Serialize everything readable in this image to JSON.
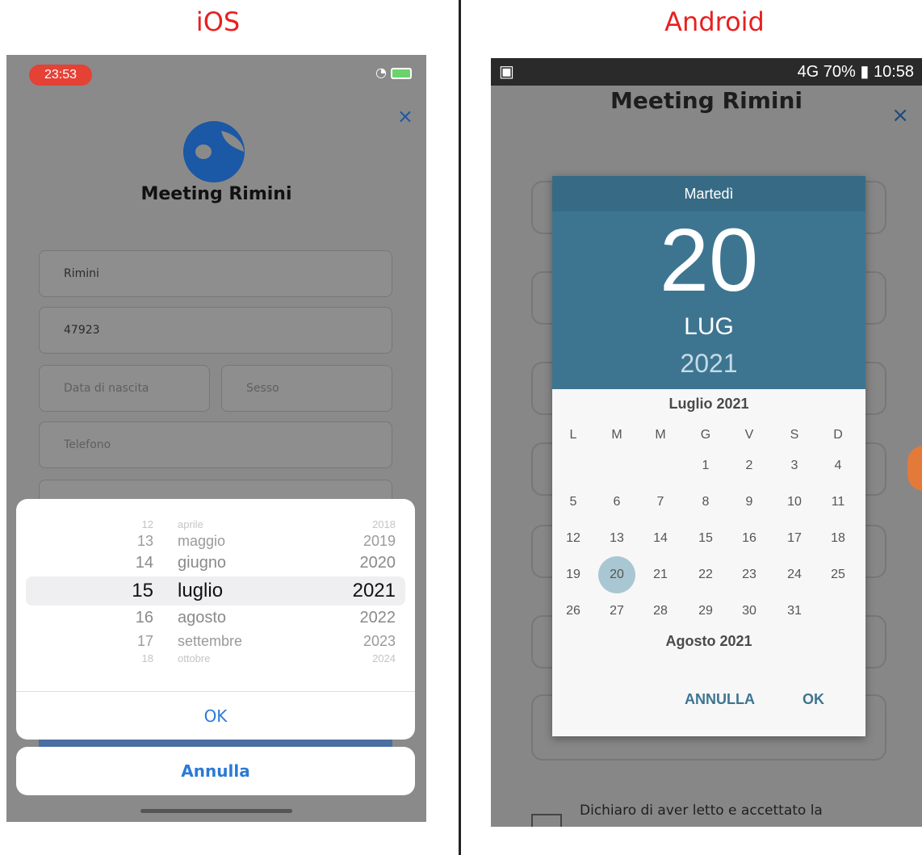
{
  "labels": {
    "ios": "iOS",
    "android": "Android"
  },
  "ios": {
    "status_time": "23:53",
    "close_glyph": "×",
    "brand": "Meeting Rimini",
    "fields": [
      {
        "name": "city-field",
        "value": "Rimini"
      },
      {
        "name": "zip-field",
        "value": "47923"
      },
      {
        "name": "birthdate-field",
        "value": "Data di nascita"
      },
      {
        "name": "sex-field",
        "value": "Sesso"
      },
      {
        "name": "phone-field",
        "value": "Telefono"
      }
    ],
    "picker": {
      "rows": [
        {
          "day": "12",
          "month": "aprile",
          "year": "2018"
        },
        {
          "day": "13",
          "month": "maggio",
          "year": "2019"
        },
        {
          "day": "14",
          "month": "giugno",
          "year": "2020"
        },
        {
          "day": "15",
          "month": "luglio",
          "year": "2021"
        },
        {
          "day": "16",
          "month": "agosto",
          "year": "2022"
        },
        {
          "day": "17",
          "month": "settembre",
          "year": "2023"
        },
        {
          "day": "18",
          "month": "ottobre",
          "year": "2024"
        }
      ],
      "ok": "OK",
      "cancel": "Annulla"
    }
  },
  "android": {
    "status_right": "4G  70% ▮ 10:58",
    "brand": "Meeting Rimini",
    "close_glyph": "×",
    "dialog": {
      "weekday": "Martedì",
      "day": "20",
      "month_short": "LUG",
      "year": "2021",
      "month_title": "Luglio 2021",
      "next_month_title": "Agosto 2021",
      "weekdays": [
        "L",
        "M",
        "M",
        "G",
        "V",
        "S",
        "D"
      ],
      "weeks": [
        [
          "",
          "",
          "",
          "1",
          "2",
          "3",
          "4"
        ],
        [
          "5",
          "6",
          "7",
          "8",
          "9",
          "10",
          "11"
        ],
        [
          "12",
          "13",
          "14",
          "15",
          "16",
          "17",
          "18"
        ],
        [
          "19",
          "20",
          "21",
          "22",
          "23",
          "24",
          "25"
        ],
        [
          "26",
          "27",
          "28",
          "29",
          "30",
          "31",
          ""
        ]
      ],
      "selected": "20",
      "cancel": "ANNULLA",
      "ok": "OK"
    },
    "declaration": "Dichiaro di aver letto e accettato la"
  },
  "colors": {
    "title_red": "#e8201f",
    "ios_blue": "#2b7ad5",
    "android_teal": "#3d7591"
  }
}
